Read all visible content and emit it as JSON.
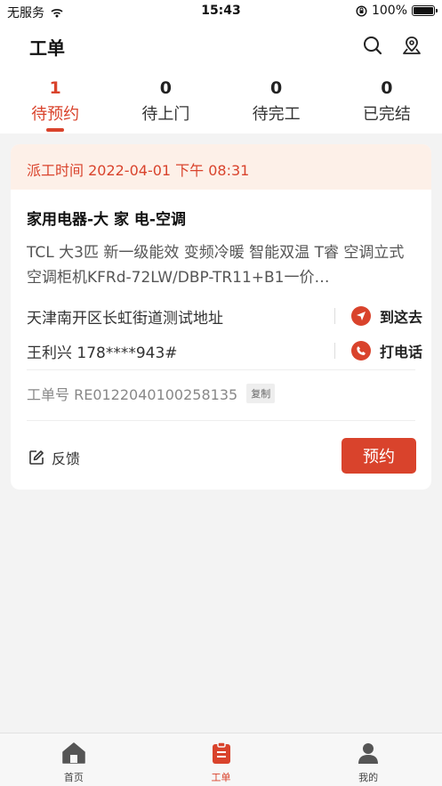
{
  "status_bar": {
    "carrier": "无服务",
    "time": "15:43",
    "battery": "100%",
    "battery_level": 1.0
  },
  "header": {
    "title": "工单",
    "icons": [
      "search-icon",
      "location-pin-icon"
    ]
  },
  "tabs": [
    {
      "count": "1",
      "label": "待预约",
      "active": true
    },
    {
      "count": "0",
      "label": "待上门",
      "active": false
    },
    {
      "count": "0",
      "label": "待完工",
      "active": false
    },
    {
      "count": "0",
      "label": "已完结",
      "active": false
    }
  ],
  "order": {
    "dispatch_time": "派工时间 2022-04-01 下午 08:31",
    "product_title": "家用电器-大 家 电-空调",
    "description": "TCL 大3匹 新一级能效 变频冷暖 智能双温 T睿 空调立式 空调柜机KFRd-72LW/DBP-TR11+B1一价…",
    "address": "天津南开区长虹街道测试地址",
    "navigate_label": "到这去",
    "contact": "王利兴 178****943#",
    "call_label": "打电话",
    "ticket_number": "工单号 RE0122040100258135",
    "copy_label": "复制",
    "feedback_label": "反馈",
    "reserve_label": "预约"
  },
  "bottom_nav": [
    {
      "label": "首页",
      "icon": "home-icon",
      "active": false
    },
    {
      "label": "工单",
      "icon": "clipboard-icon",
      "active": true
    },
    {
      "label": "我的",
      "icon": "user-icon",
      "active": false
    }
  ],
  "colors": {
    "accent": "#d9432c",
    "dispatch_bg": "#fdf0e8",
    "page_bg": "#f3f3f3"
  }
}
